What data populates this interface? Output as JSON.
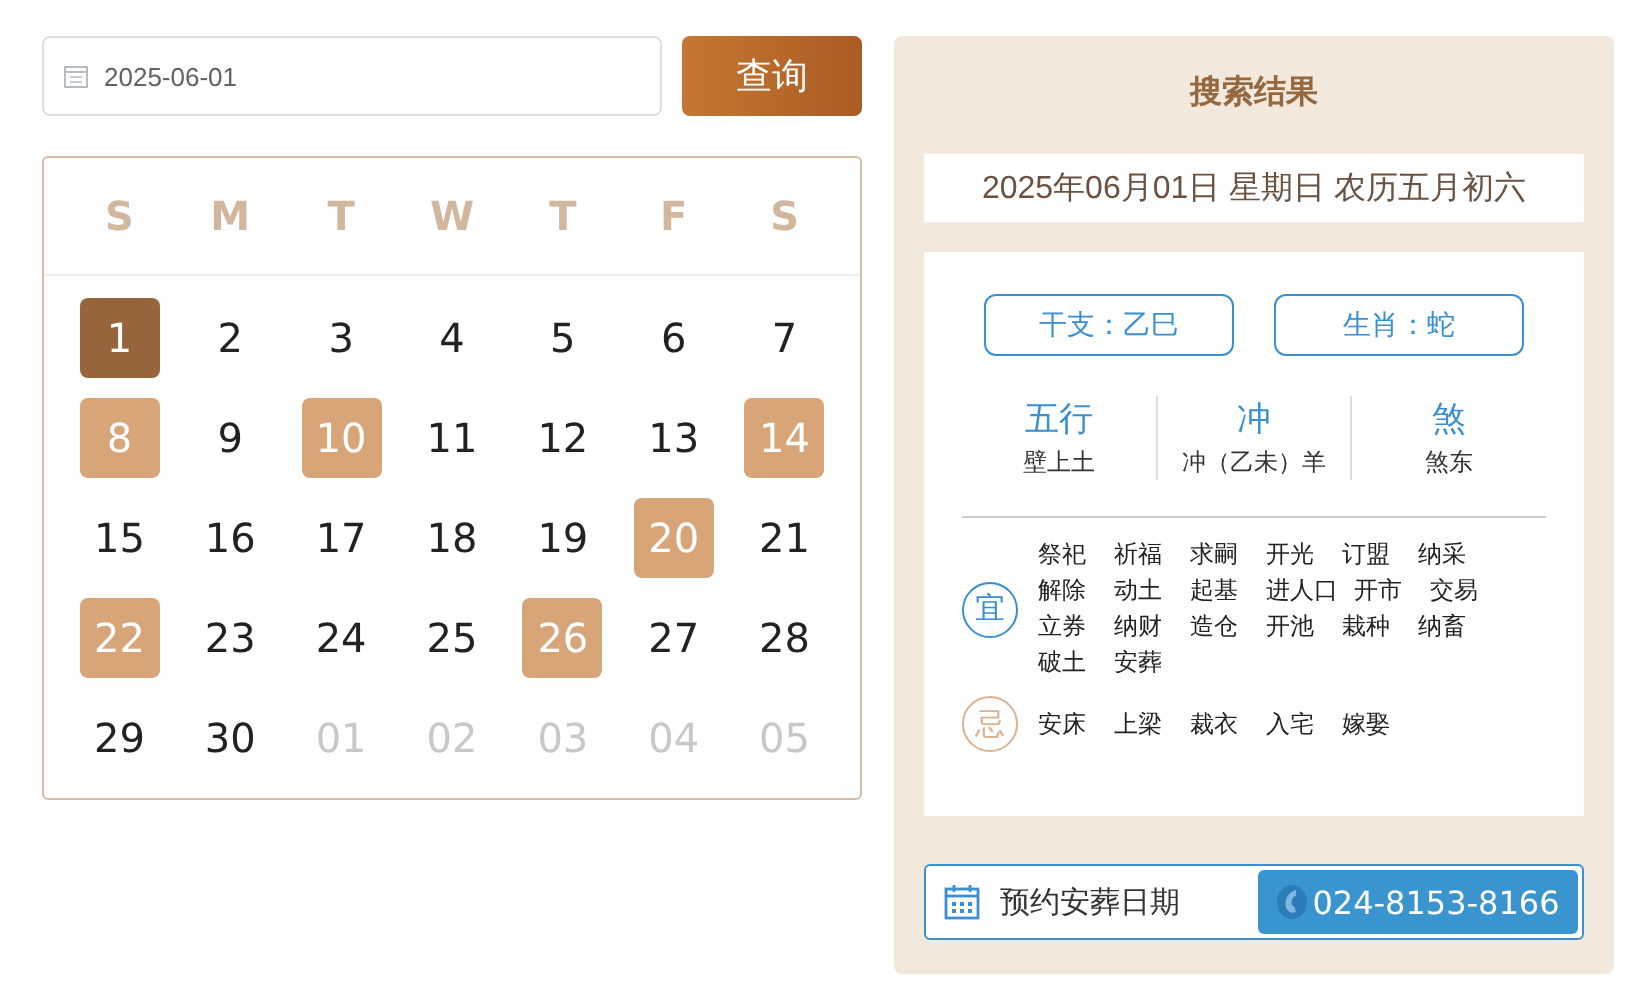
{
  "search": {
    "value": "2025-06-01",
    "button": "查询"
  },
  "calendar": {
    "weekdays": [
      "S",
      "M",
      "T",
      "W",
      "T",
      "F",
      "S"
    ],
    "days": [
      {
        "label": "1",
        "selected": true,
        "marked": false,
        "outside": false
      },
      {
        "label": "2",
        "selected": false,
        "marked": false,
        "outside": false
      },
      {
        "label": "3",
        "selected": false,
        "marked": false,
        "outside": false
      },
      {
        "label": "4",
        "selected": false,
        "marked": false,
        "outside": false
      },
      {
        "label": "5",
        "selected": false,
        "marked": false,
        "outside": false
      },
      {
        "label": "6",
        "selected": false,
        "marked": false,
        "outside": false
      },
      {
        "label": "7",
        "selected": false,
        "marked": false,
        "outside": false
      },
      {
        "label": "8",
        "selected": false,
        "marked": true,
        "outside": false
      },
      {
        "label": "9",
        "selected": false,
        "marked": false,
        "outside": false
      },
      {
        "label": "10",
        "selected": false,
        "marked": true,
        "outside": false
      },
      {
        "label": "11",
        "selected": false,
        "marked": false,
        "outside": false
      },
      {
        "label": "12",
        "selected": false,
        "marked": false,
        "outside": false
      },
      {
        "label": "13",
        "selected": false,
        "marked": false,
        "outside": false
      },
      {
        "label": "14",
        "selected": false,
        "marked": true,
        "outside": false
      },
      {
        "label": "15",
        "selected": false,
        "marked": false,
        "outside": false
      },
      {
        "label": "16",
        "selected": false,
        "marked": false,
        "outside": false
      },
      {
        "label": "17",
        "selected": false,
        "marked": false,
        "outside": false
      },
      {
        "label": "18",
        "selected": false,
        "marked": false,
        "outside": false
      },
      {
        "label": "19",
        "selected": false,
        "marked": false,
        "outside": false
      },
      {
        "label": "20",
        "selected": false,
        "marked": true,
        "outside": false
      },
      {
        "label": "21",
        "selected": false,
        "marked": false,
        "outside": false
      },
      {
        "label": "22",
        "selected": false,
        "marked": true,
        "outside": false
      },
      {
        "label": "23",
        "selected": false,
        "marked": false,
        "outside": false
      },
      {
        "label": "24",
        "selected": false,
        "marked": false,
        "outside": false
      },
      {
        "label": "25",
        "selected": false,
        "marked": false,
        "outside": false
      },
      {
        "label": "26",
        "selected": false,
        "marked": true,
        "outside": false
      },
      {
        "label": "27",
        "selected": false,
        "marked": false,
        "outside": false
      },
      {
        "label": "28",
        "selected": false,
        "marked": false,
        "outside": false
      },
      {
        "label": "29",
        "selected": false,
        "marked": false,
        "outside": false
      },
      {
        "label": "30",
        "selected": false,
        "marked": false,
        "outside": false
      },
      {
        "label": "01",
        "selected": false,
        "marked": false,
        "outside": true
      },
      {
        "label": "02",
        "selected": false,
        "marked": false,
        "outside": true
      },
      {
        "label": "03",
        "selected": false,
        "marked": false,
        "outside": true
      },
      {
        "label": "04",
        "selected": false,
        "marked": false,
        "outside": true
      },
      {
        "label": "05",
        "selected": false,
        "marked": false,
        "outside": true
      }
    ]
  },
  "result": {
    "title": "搜索结果",
    "date": "2025年06月01日 星期日 农历五月初六",
    "tags": [
      "干支：乙巳",
      "生肖：蛇"
    ],
    "stats": [
      {
        "heading": "五行",
        "value": "壁上土"
      },
      {
        "heading": "冲",
        "value": "冲（乙未）羊"
      },
      {
        "heading": "煞",
        "value": "煞东"
      }
    ],
    "suitable": {
      "mark": "宜",
      "items": [
        "祭祀",
        "祈福",
        "求嗣",
        "开光",
        "订盟",
        "纳采",
        "解除",
        "动土",
        "起基",
        "进人口",
        "开市",
        "交易",
        "立券",
        "纳财",
        "造仓",
        "开池",
        "栽种",
        "纳畜",
        "破土",
        "安葬"
      ]
    },
    "avoid": {
      "mark": "忌",
      "items": [
        "安床",
        "上梁",
        "裁衣",
        "入宅",
        "嫁娶"
      ]
    },
    "booking": {
      "label": "预约安葬日期",
      "phone": "024-8153-8166"
    }
  }
}
